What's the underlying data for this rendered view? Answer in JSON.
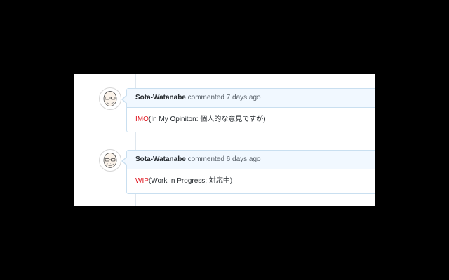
{
  "comments": [
    {
      "author": "Sota-Watanabe",
      "meta": "commented 7 days ago",
      "keyword": "IMO",
      "text": "(In My Opiniton: 個人的な意見ですが)"
    },
    {
      "author": "Sota-Watanabe",
      "meta": "commented 6 days ago",
      "keyword": "WIP",
      "text": "(Work In Progress: 対応中)"
    }
  ],
  "colors": {
    "background": "#000000",
    "header_bg": "#f1f8ff",
    "border": "#c9dff0",
    "keyword": "#e0141e"
  },
  "icons": {
    "avatar": "user-avatar-icon"
  }
}
